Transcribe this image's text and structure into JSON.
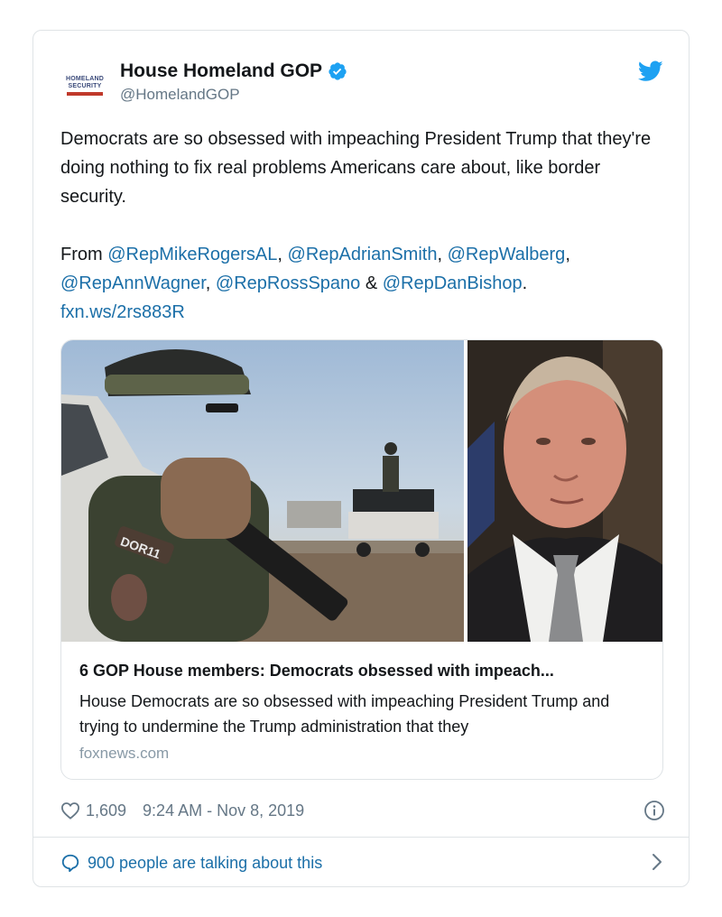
{
  "account": {
    "display_name": "House Homeland GOP",
    "handle": "@HomelandGOP",
    "verified": true,
    "avatar_text_line1": "HOMELAND",
    "avatar_text_line2": "SECURITY"
  },
  "tweet": {
    "paragraph1": "Democrats are so obsessed with impeaching President Trump that they're doing nothing to fix real problems Americans care about, like border security.",
    "from_label": "From",
    "mentions": [
      "@RepMikeRogersAL",
      "@RepAdrianSmith",
      "@RepWalberg",
      "@RepAnnWagner",
      "@RepRossSpano",
      "@RepDanBishop"
    ],
    "sep_comma": ",",
    "sep_amp": "&",
    "end_period": ".",
    "link": "fxn.ws/2rs883R"
  },
  "link_card": {
    "title": "6 GOP House members: Democrats obsessed with impeach...",
    "description": "House Democrats are so obsessed with impeaching President Trump and trying to undermine the Trump administration that they",
    "domain": "foxnews.com",
    "patch_text": "DOR11"
  },
  "meta": {
    "likes": "1,609",
    "timestamp": "9:24 AM - Nov 8, 2019"
  },
  "footer": {
    "talking": "900 people are talking about this"
  },
  "icons": {
    "verified": "verified-badge-icon",
    "bird": "twitter-bird-icon",
    "heart": "heart-icon",
    "info": "info-icon",
    "bubble": "comment-bubble-icon",
    "chevron": "chevron-right-icon"
  },
  "colors": {
    "link": "#1b6fa8",
    "twitter_blue": "#1da1f2",
    "muted": "#657786",
    "border": "#dfe3e6"
  }
}
